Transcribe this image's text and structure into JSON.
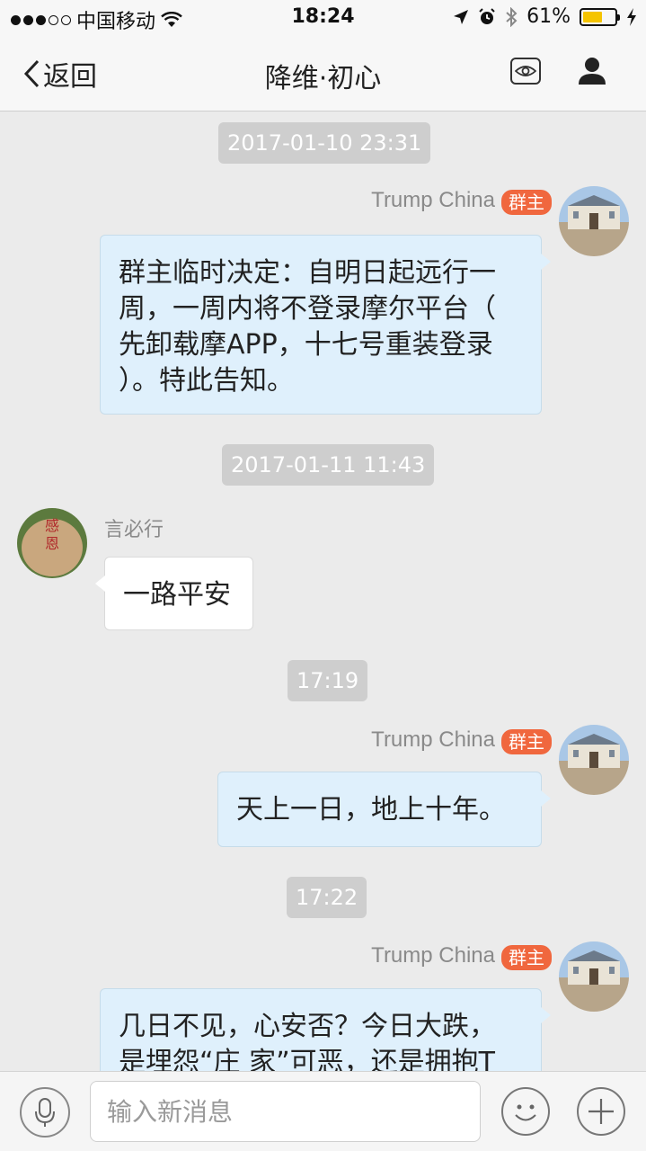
{
  "status_bar": {
    "carrier": "中国移动",
    "time": "18:24",
    "battery_percent": "61%",
    "battery_level": 0.61
  },
  "nav": {
    "back_label": "返回",
    "title": "降维·初心"
  },
  "messages": [
    {
      "type": "timestamp",
      "text": "2017-01-10 23:31"
    },
    {
      "type": "outgoing",
      "sender": "Trump China",
      "badge": "群主",
      "lines": [
        "群主临时决定：自明日起远行一",
        "周，一周内将不登录摩尔平台（",
        "先卸载摩APP，十七号重装登录",
        "）。特此告知。"
      ]
    },
    {
      "type": "timestamp",
      "text": "2017-01-11 11:43"
    },
    {
      "type": "incoming",
      "sender": "言必行",
      "avatar_text": "感恩",
      "text": "一路平安"
    },
    {
      "type": "timestamp",
      "text": "17:19"
    },
    {
      "type": "outgoing",
      "sender": "Trump China",
      "badge": "群主",
      "text": "天上一日，地上十年。"
    },
    {
      "type": "timestamp",
      "text": "17:22"
    },
    {
      "type": "outgoing",
      "sender": "Trump China",
      "badge": "群主",
      "lines": [
        "几日不见，心安否？今日大跌，",
        "是埋怨“庄 家”可恶，还是拥抱T"
      ]
    }
  ],
  "input_bar": {
    "placeholder": "输入新消息"
  },
  "colors": {
    "badge": "#f0673e",
    "outgoing_bubble": "#dff0fc",
    "incoming_bubble": "#ffffff",
    "timestamp_bg": "#cecece",
    "battery": "#f5c400"
  },
  "icons": [
    "wifi-icon",
    "location-arrow-icon",
    "alarm-icon",
    "bluetooth-icon",
    "charging-icon",
    "back-chevron-icon",
    "eye-icon",
    "person-icon",
    "microphone-icon",
    "emoji-icon",
    "plus-icon"
  ]
}
